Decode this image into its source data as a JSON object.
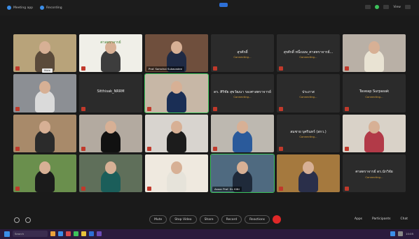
{
  "topbar": {
    "left_items": [
      "Meeting app",
      "Recording"
    ],
    "right_label": "View"
  },
  "tiles": [
    {
      "type": "video",
      "bg": "#b8a37a",
      "body": "#5a4a3a",
      "name": ""
    },
    {
      "type": "video",
      "bg": "#f0efe8",
      "body": "#3d3d3d",
      "name": "",
      "banner": "ศาสตราจารย์"
    },
    {
      "type": "video",
      "bg": "#6f4f3d",
      "body": "#1f2a44",
      "name": "Prof. Somchai Sukavadee"
    },
    {
      "type": "text",
      "title": "สุรศักดิ์",
      "sub": "Connecting..."
    },
    {
      "type": "text",
      "title": "สุรศักดิ์ หนึ่งเมษ_ศาสตราจารย์...",
      "sub": "Connecting..."
    },
    {
      "type": "video",
      "bg": "#b9b0a6",
      "body": "#e9e3d3",
      "name": ""
    },
    {
      "type": "video",
      "bg": "#8c8f94",
      "body": "#dadada",
      "name": ""
    },
    {
      "type": "text",
      "title": "Sitthisak_NRRM",
      "sub": ""
    },
    {
      "type": "video",
      "bg": "#c7b7a6",
      "body": "#1a2e55",
      "name": "",
      "active": true
    },
    {
      "type": "text",
      "title": "ดร. ศิริชัย สุขวัฒนา รองศาสตราจารย์",
      "sub": "Connecting..."
    },
    {
      "type": "text",
      "title": "ประภาส",
      "sub": "Connecting..."
    },
    {
      "type": "text",
      "title": "Taveap Surpasak",
      "sub": "Connecting..."
    },
    {
      "type": "video",
      "bg": "#a88a6a",
      "body": "#2b2b2b",
      "name": ""
    },
    {
      "type": "video",
      "bg": "#b3aaa0",
      "body": "#111111",
      "name": ""
    },
    {
      "type": "video",
      "bg": "#d8d4cf",
      "body": "#1c1c1c",
      "name": ""
    },
    {
      "type": "video",
      "bg": "#bdb8b0",
      "body": "#2a5a9b",
      "name": ""
    },
    {
      "type": "text",
      "title": "สมชาย บุศรินทร์ (สกว.)",
      "sub": "Connecting..."
    },
    {
      "type": "video",
      "bg": "#d9d2c8",
      "body": "#b23a48",
      "name": ""
    },
    {
      "type": "video",
      "bg": "#6a8f4d",
      "body": "#1b1b1b",
      "name": ""
    },
    {
      "type": "video",
      "bg": "#5f6f5a",
      "body": "#1b5e5a",
      "name": ""
    },
    {
      "type": "video",
      "bg": "#efe9df",
      "body": "#e6e3da",
      "name": ""
    },
    {
      "type": "video",
      "bg": "#4f6a80",
      "body": "#1f2a3a",
      "name": "Assoc Prof. Dr. Kitti",
      "active": true
    },
    {
      "type": "video",
      "bg": "#a5793e",
      "body": "#2a2f4a",
      "name": ""
    },
    {
      "type": "text",
      "title": "ศาสตราจารย์ ดร.นักวิจัย",
      "sub": "Connecting..."
    }
  ],
  "tooltip": "Mute",
  "toolbar": {
    "buttons": [
      "Mute",
      "Stop Video",
      "Share",
      "Record",
      "Reactions"
    ],
    "right": [
      "Apps",
      "Participants",
      "Chat"
    ]
  },
  "taskbar": {
    "search": "Search",
    "time": "10:05"
  }
}
